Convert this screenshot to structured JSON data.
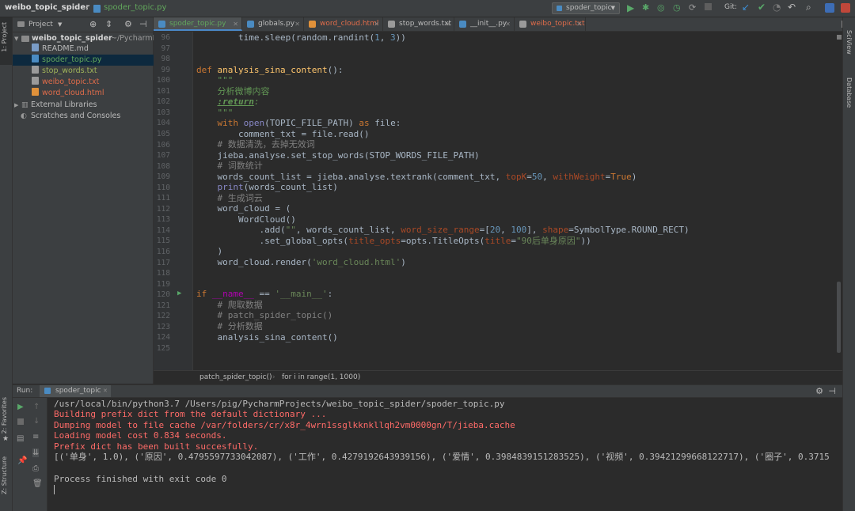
{
  "navbar": {
    "project": "weibo_topic_spider",
    "file": "spoder_topic.py",
    "run_config": "spoder_topic",
    "git_label": "Git:"
  },
  "tabs": [
    {
      "label": "spoder_topic.py",
      "color": "#62a85c",
      "active": true
    },
    {
      "label": "globals.py",
      "color": "#bbbbbb",
      "active": false
    },
    {
      "label": "word_cloud.html",
      "color": "#e06c4a",
      "active": false
    },
    {
      "label": "stop_words.txt",
      "color": "#bbbbbb",
      "active": false
    },
    {
      "label": "__init__.py",
      "color": "#bbbbbb",
      "active": false
    },
    {
      "label": "weibo_topic.txt",
      "color": "#e06c4a",
      "active": false
    }
  ],
  "left_stripe": {
    "project": "1: Project",
    "favorites": "2: Favorites",
    "structure": "Z: Structure"
  },
  "right_stripe": {
    "sciview": "SciView",
    "database": "Database"
  },
  "project_panel": {
    "title": "Project",
    "root": "weibo_topic_spider",
    "root_path": "~/PycharmP",
    "items": [
      {
        "label": "README.md",
        "color": "#bbbbbb",
        "icon": "#7a9cc6"
      },
      {
        "label": "spoder_topic.py",
        "color": "#62a85c",
        "icon": "#4a8bc2",
        "selected": true
      },
      {
        "label": "stop_words.txt",
        "color": "#9fb35a",
        "icon": "#9a9a9a"
      },
      {
        "label": "weibo_topic.txt",
        "color": "#e06c4a",
        "icon": "#9a9a9a"
      },
      {
        "label": "word_cloud.html",
        "color": "#e06c4a",
        "icon": "#e0913a"
      }
    ],
    "external": "External Libraries",
    "scratches": "Scratches and Consoles"
  },
  "editor": {
    "line_numbers": [
      "96",
      "97",
      "98",
      "99",
      "100",
      "101",
      "102",
      "103",
      "104",
      "105",
      "106",
      "107",
      "108",
      "109",
      "110",
      "111",
      "112",
      "113",
      "114",
      "115",
      "116",
      "117",
      "118",
      "119",
      "120",
      "121",
      "122",
      "123",
      "124",
      "125"
    ],
    "breadcrumb": [
      "patch_spider_topic()",
      "for i in range(1, 1000)"
    ]
  },
  "run": {
    "label": "Run:",
    "tab": "spoder_topic",
    "lines": [
      {
        "text": "/usr/local/bin/python3.7 /Users/pig/PycharmProjects/weibo_topic_spider/spoder_topic.py",
        "color": "#bbbbbb"
      },
      {
        "text": "Building prefix dict from the default dictionary ...",
        "color": "#ff6b68"
      },
      {
        "text": "Dumping model to file cache /var/folders/cr/x8r_4wrn1ssglkknkllqh2vm0000gn/T/jieba.cache",
        "color": "#ff6b68"
      },
      {
        "text": "Loading model cost 0.834 seconds.",
        "color": "#ff6b68"
      },
      {
        "text": "Prefix dict has been built succesfully.",
        "color": "#ff6b68"
      },
      {
        "text": "[('单身', 1.0), ('原因', 0.4795597733042087), ('工作', 0.4279192643939156), ('爱情', 0.3984839151283525), ('视频', 0.39421299668122717), ('圈子', 0.3715",
        "color": "#bbbbbb"
      },
      {
        "text": "",
        "color": "#bbbbbb"
      },
      {
        "text": "Process finished with exit code 0",
        "color": "#bbbbbb"
      }
    ]
  }
}
